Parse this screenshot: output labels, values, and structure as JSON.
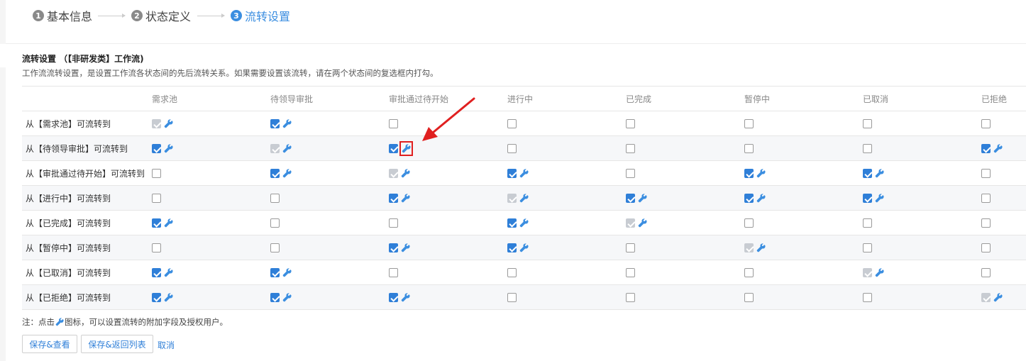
{
  "stepper": {
    "steps": [
      {
        "num": "1",
        "label": "基本信息"
      },
      {
        "num": "2",
        "label": "状态定义"
      },
      {
        "num": "3",
        "label": "流转设置"
      }
    ],
    "active_index": 2
  },
  "section": {
    "title": "流转设置 （【非研发类】工作流)",
    "description": "工作流流转设置，是设置工作流各状态间的先后流转关系。如果需要设置该流转，请在两个状态间的复选框内打勾。"
  },
  "table": {
    "columns": [
      "需求池",
      "待领导审批",
      "审批通过待开始",
      "进行中",
      "已完成",
      "暂停中",
      "已取消",
      "已拒绝"
    ],
    "rows": [
      {
        "label": "从【需求池】可流转到",
        "cells": [
          "self",
          "checked",
          "empty",
          "empty",
          "empty",
          "empty",
          "empty",
          "empty"
        ]
      },
      {
        "label": "从【待领导审批】可流转到",
        "cells": [
          "checked",
          "self",
          "checked",
          "empty",
          "empty",
          "empty",
          "empty",
          "checked"
        ]
      },
      {
        "label": "从【审批通过待开始】可流转到",
        "cells": [
          "empty",
          "checked",
          "self",
          "checked",
          "empty",
          "checked",
          "checked",
          "empty"
        ]
      },
      {
        "label": "从【进行中】可流转到",
        "cells": [
          "empty",
          "empty",
          "checked",
          "self",
          "checked",
          "checked",
          "checked",
          "empty"
        ]
      },
      {
        "label": "从【已完成】可流转到",
        "cells": [
          "checked",
          "empty",
          "empty",
          "checked",
          "self",
          "empty",
          "empty",
          "empty"
        ]
      },
      {
        "label": "从【暂停中】可流转到",
        "cells": [
          "empty",
          "empty",
          "checked",
          "checked",
          "empty",
          "self",
          "empty",
          "empty"
        ]
      },
      {
        "label": "从【已取消】可流转到",
        "cells": [
          "checked",
          "checked",
          "empty",
          "empty",
          "empty",
          "empty",
          "self",
          "empty"
        ]
      },
      {
        "label": "从【已拒绝】可流转到",
        "cells": [
          "checked",
          "checked",
          "checked",
          "empty",
          "empty",
          "empty",
          "empty",
          "self"
        ]
      }
    ],
    "highlight": {
      "row": 1,
      "col": 2,
      "color": "#e02020"
    }
  },
  "note": {
    "prefix": "注：点击",
    "suffix": "图标，可以设置流转的附加字段及授权用户。"
  },
  "buttons": {
    "save_view": "保存&查看",
    "save_back": "保存&返回列表",
    "cancel": "取消"
  },
  "colors": {
    "accent": "#2f7fd8",
    "active_step": "#3b8ee0",
    "annotation": "#e02020"
  },
  "icons": {
    "config": "wrench-icon",
    "annotation": "red-arrow-annotation"
  }
}
